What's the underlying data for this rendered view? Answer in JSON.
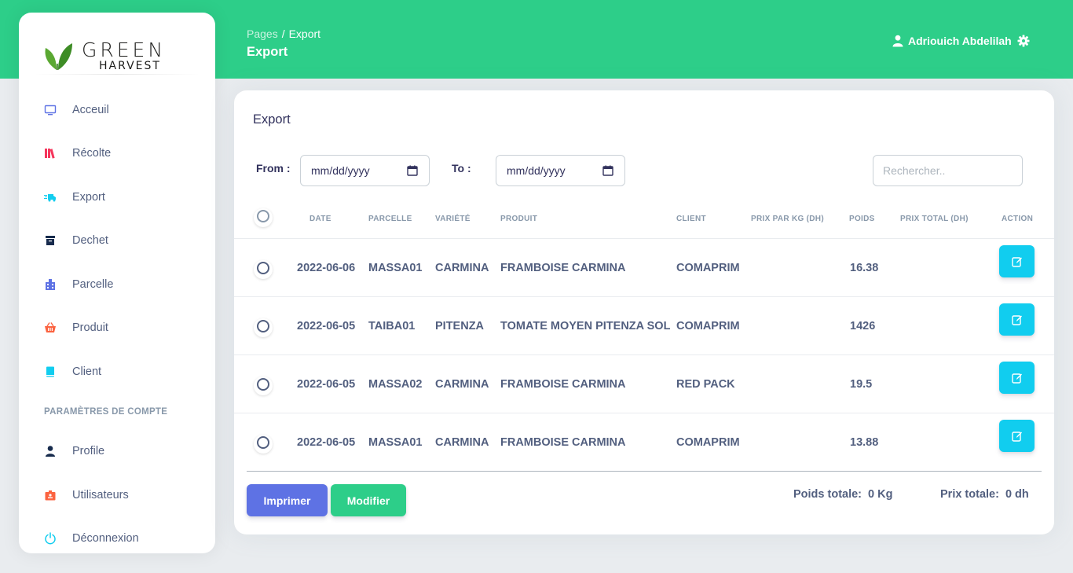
{
  "brand": {
    "line1": "GREEN",
    "line2": "HARVEST"
  },
  "sidebar": {
    "items": [
      {
        "label": "Acceuil",
        "icon": "monitor-icon"
      },
      {
        "label": "Récolte",
        "icon": "books-icon"
      },
      {
        "label": "Export",
        "icon": "truck-fast-icon"
      },
      {
        "label": "Dechet",
        "icon": "archive-box-icon"
      },
      {
        "label": "Parcelle",
        "icon": "building-icon"
      },
      {
        "label": "Produit",
        "icon": "basket-icon"
      },
      {
        "label": "Client",
        "icon": "book-icon"
      }
    ],
    "section_title": "PARAMÈTRES DE COMPTE",
    "account_items": [
      {
        "label": "Profile",
        "icon": "user-icon"
      },
      {
        "label": "Utilisateurs",
        "icon": "id-badge-icon"
      },
      {
        "label": "Déconnexion",
        "icon": "power-icon"
      }
    ]
  },
  "header": {
    "breadcrumb_root": "Pages",
    "breadcrumb_sep": "/",
    "breadcrumb_current": "Export",
    "title": "Export",
    "user_name": "Adriouich Abdelilah"
  },
  "card": {
    "title": "Export",
    "from_label": "From :",
    "to_label": "To :",
    "from_value": "mm/dd/yyyy",
    "to_value": "mm/dd/yyyy",
    "search_placeholder": "Rechercher.."
  },
  "table": {
    "columns": [
      "DATE",
      "PARCELLE",
      "VARIÉTÉ",
      "PRODUIT",
      "CLIENT",
      "PRIX PAR KG (DH)",
      "POIDS",
      "PRIX TOTAL (DH)",
      "ACTION"
    ],
    "rows": [
      {
        "date": "2022-06-06",
        "parcelle": "MASSA01",
        "variete": "CARMINA",
        "produit": "FRAMBOISE CARMINA",
        "client": "COMAPRIM",
        "prix_kg": "",
        "poids": "16.38",
        "prix_total": ""
      },
      {
        "date": "2022-06-05",
        "parcelle": "TAIBA01",
        "variete": "PITENZA",
        "produit": "TOMATE MOYEN PITENZA SOL",
        "client": "COMAPRIM",
        "prix_kg": "",
        "poids": "1426",
        "prix_total": ""
      },
      {
        "date": "2022-06-05",
        "parcelle": "MASSA02",
        "variete": "CARMINA",
        "produit": "FRAMBOISE CARMINA",
        "client": "RED PACK",
        "prix_kg": "",
        "poids": "19.5",
        "prix_total": ""
      },
      {
        "date": "2022-06-05",
        "parcelle": "MASSA01",
        "variete": "CARMINA",
        "produit": "FRAMBOISE CARMINA",
        "client": "COMAPRIM",
        "prix_kg": "",
        "poids": "13.88",
        "prix_total": ""
      }
    ]
  },
  "footer": {
    "print_label": "Imprimer",
    "modify_label": "Modifier",
    "poids_label": "Poids totale:",
    "poids_value": "0 Kg",
    "prix_label": "Prix totale:",
    "prix_value": "0 dh"
  },
  "colors": {
    "header_bg": "#2dce89",
    "primary": "#5e72e4",
    "success": "#2dce89",
    "info": "#11cdef"
  }
}
